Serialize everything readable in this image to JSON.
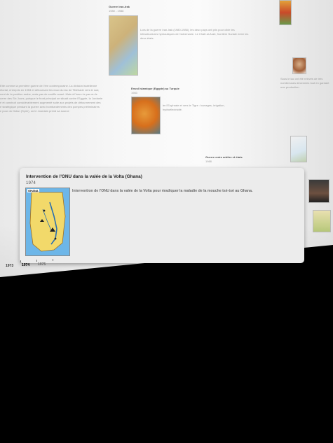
{
  "background_page": {
    "top_item_title": "Guerre Iran-Irak",
    "top_item_year": "1980 - 1988",
    "mid_item_title": "Envol Islamique (Egypte) au Turquie",
    "mid_item_year": "1983",
    "left_paragraph_lines": [
      "Ette comme la première guerre de l'ère contemporaine. La division israélienne",
      "ritorial, entrepris en 1953 et détournant les eaux du lac de Tibériade vers le sud,",
      "nent de la position arabe, mais pas de souffle avant. Mais à l'issu n'a pas eu le",
      "uerre des Six Jours, puisque le front principal se situait contre l'Egypte, la Jordanie",
      "é stratégique pendant la guerre avec bombardements des pompes préliminaires",
      "e pour du Golan (Syrie), où le Jourdain prend sa source",
      "é et construit considérablement augmenté suite aux projets de détournement des"
    ],
    "lower_item_title": "Guerre entre arbitre et états",
    "lower_item_year": "1988"
  },
  "card": {
    "title": "Intervention de l'ONU dans la valée de la Volta (Ghana)",
    "year": "1974",
    "description": "Intervention de l'ONU dans la valée de la Volta pour éradiquer la maladie de la mouche tsé-tsé au Ghana.",
    "map_label": "GHANA"
  },
  "timeline": {
    "years": [
      "1973",
      "1974",
      "1975"
    ],
    "selected": "1974"
  },
  "colors": {
    "accent": "#e06010",
    "map_water": "#6db6e8",
    "map_land": "#f2d96a"
  }
}
